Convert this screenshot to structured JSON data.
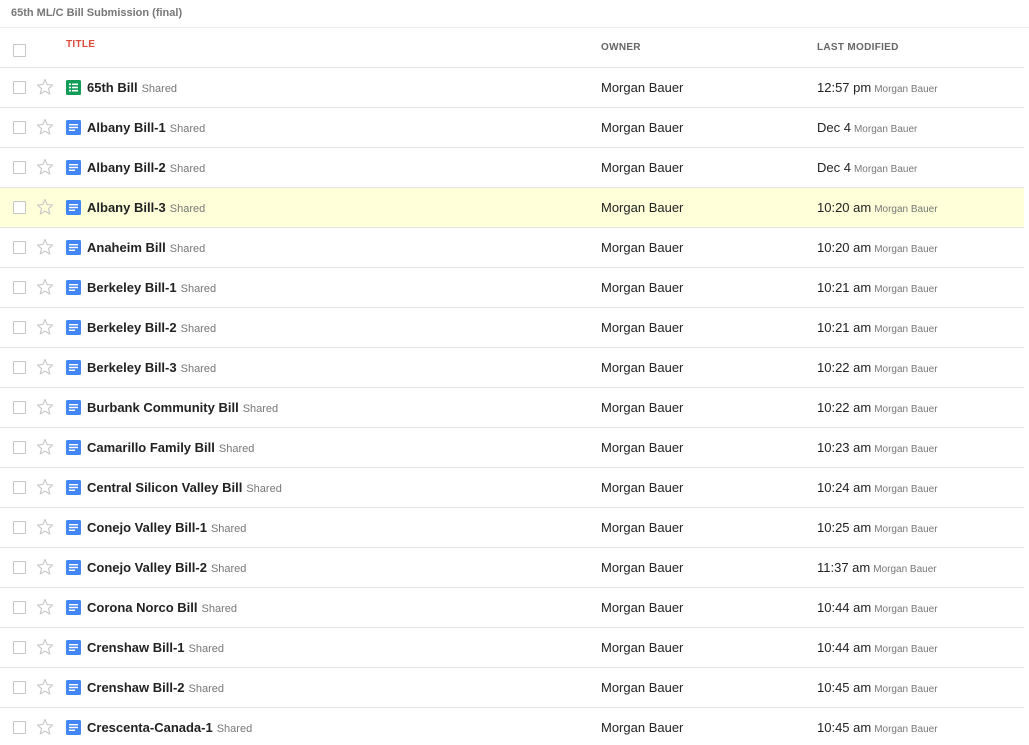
{
  "folder": {
    "title": "65th ML/C Bill Submission (final)"
  },
  "columns": {
    "title": "TITLE",
    "owner": "OWNER",
    "last_modified": "LAST MODIFIED"
  },
  "colors": {
    "sort_column": "#dd4b39",
    "doc_icon": "#4285f4",
    "sheet_icon": "#0f9d58",
    "highlight_row": "#ffffd9"
  },
  "rows": [
    {
      "icon": "spreadsheet-icon",
      "title": "65th Bill",
      "shared": "Shared",
      "owner": "Morgan Bauer",
      "modified": "12:57 pm",
      "modified_by": "Morgan Bauer"
    },
    {
      "icon": "document-icon",
      "title": "Albany Bill-1",
      "shared": "Shared",
      "owner": "Morgan Bauer",
      "modified": "Dec 4",
      "modified_by": "Morgan Bauer"
    },
    {
      "icon": "document-icon",
      "title": "Albany Bill-2",
      "shared": "Shared",
      "owner": "Morgan Bauer",
      "modified": "Dec 4",
      "modified_by": "Morgan Bauer"
    },
    {
      "icon": "document-icon",
      "title": "Albany Bill-3",
      "shared": "Shared",
      "owner": "Morgan Bauer",
      "modified": "10:20 am",
      "modified_by": "Morgan Bauer",
      "highlighted": true
    },
    {
      "icon": "document-icon",
      "title": "Anaheim Bill",
      "shared": "Shared",
      "owner": "Morgan Bauer",
      "modified": "10:20 am",
      "modified_by": "Morgan Bauer"
    },
    {
      "icon": "document-icon",
      "title": "Berkeley Bill-1",
      "shared": "Shared",
      "owner": "Morgan Bauer",
      "modified": "10:21 am",
      "modified_by": "Morgan Bauer"
    },
    {
      "icon": "document-icon",
      "title": "Berkeley Bill-2",
      "shared": "Shared",
      "owner": "Morgan Bauer",
      "modified": "10:21 am",
      "modified_by": "Morgan Bauer"
    },
    {
      "icon": "document-icon",
      "title": "Berkeley Bill-3",
      "shared": "Shared",
      "owner": "Morgan Bauer",
      "modified": "10:22 am",
      "modified_by": "Morgan Bauer"
    },
    {
      "icon": "document-icon",
      "title": "Burbank Community Bill",
      "shared": "Shared",
      "owner": "Morgan Bauer",
      "modified": "10:22 am",
      "modified_by": "Morgan Bauer"
    },
    {
      "icon": "document-icon",
      "title": "Camarillo Family Bill",
      "shared": "Shared",
      "owner": "Morgan Bauer",
      "modified": "10:23 am",
      "modified_by": "Morgan Bauer"
    },
    {
      "icon": "document-icon",
      "title": "Central Silicon Valley Bill",
      "shared": "Shared",
      "owner": "Morgan Bauer",
      "modified": "10:24 am",
      "modified_by": "Morgan Bauer"
    },
    {
      "icon": "document-icon",
      "title": "Conejo Valley Bill-1",
      "shared": "Shared",
      "owner": "Morgan Bauer",
      "modified": "10:25 am",
      "modified_by": "Morgan Bauer"
    },
    {
      "icon": "document-icon",
      "title": "Conejo Valley Bill-2",
      "shared": "Shared",
      "owner": "Morgan Bauer",
      "modified": "11:37 am",
      "modified_by": "Morgan Bauer"
    },
    {
      "icon": "document-icon",
      "title": "Corona Norco Bill",
      "shared": "Shared",
      "owner": "Morgan Bauer",
      "modified": "10:44 am",
      "modified_by": "Morgan Bauer"
    },
    {
      "icon": "document-icon",
      "title": "Crenshaw Bill-1",
      "shared": "Shared",
      "owner": "Morgan Bauer",
      "modified": "10:44 am",
      "modified_by": "Morgan Bauer"
    },
    {
      "icon": "document-icon",
      "title": "Crenshaw Bill-2",
      "shared": "Shared",
      "owner": "Morgan Bauer",
      "modified": "10:45 am",
      "modified_by": "Morgan Bauer"
    },
    {
      "icon": "document-icon",
      "title": "Crescenta-Canada-1",
      "shared": "Shared",
      "owner": "Morgan Bauer",
      "modified": "10:45 am",
      "modified_by": "Morgan Bauer"
    }
  ]
}
